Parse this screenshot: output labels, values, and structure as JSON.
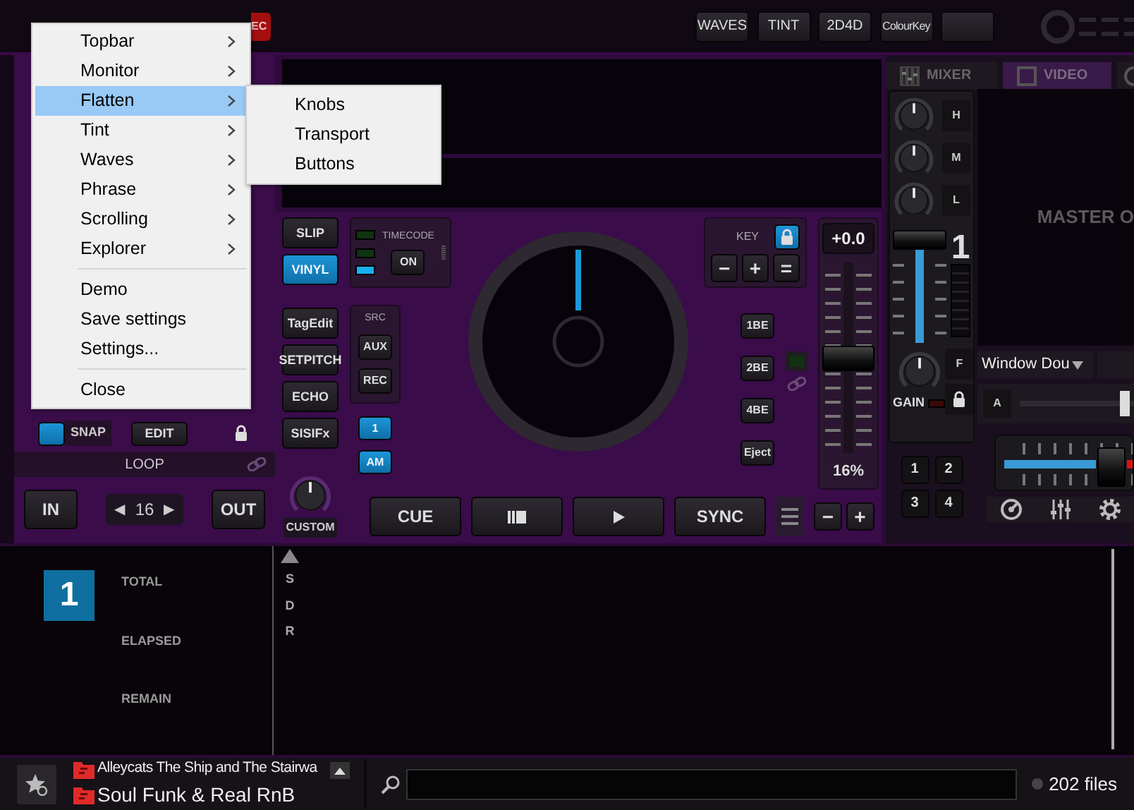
{
  "topbar": {
    "rec_label": "EC",
    "buttons": [
      {
        "label": "WAVES"
      },
      {
        "label": "TINT"
      },
      {
        "label": "2D4D"
      },
      {
        "label": "ColourKey"
      }
    ]
  },
  "deck": {
    "snap": {
      "label": "SNAP",
      "on": true
    },
    "edit_label": "EDIT",
    "loop_label": "LOOP",
    "loop_in": "IN",
    "loop_out": "OUT",
    "loop_prev": "◀",
    "loop_size": "16",
    "loop_next": "▶",
    "side_buttons": [
      {
        "label": "SLIP",
        "on": false
      },
      {
        "label": "VINYL",
        "on": true
      },
      {
        "label": "TagEdit",
        "on": false
      },
      {
        "label": "SETPITCH",
        "on": false
      },
      {
        "label": "ECHO",
        "on": false
      },
      {
        "label": "SISIFx",
        "on": false
      }
    ],
    "custom_label": "CUSTOM",
    "timecode": {
      "label": "TIMECODE",
      "button": "ON",
      "leds": [
        {
          "on": false
        },
        {
          "on": false
        },
        {
          "on": true
        }
      ]
    },
    "source": {
      "label": "SRC",
      "buttons": [
        "AUX",
        "REC"
      ]
    },
    "channel_buttons": [
      {
        "label": "1",
        "on": true
      },
      {
        "label": "AM",
        "on": true
      }
    ],
    "key": {
      "label": "KEY",
      "locked": true,
      "buttons": [
        "−",
        "+",
        "="
      ]
    },
    "beat_buttons": [
      "1BE",
      "2BE",
      "4BE",
      "Eject"
    ],
    "pitch": {
      "reading": "+0.0",
      "level": 0.5,
      "range": "16%",
      "buttons": [
        "−",
        "+"
      ]
    },
    "transport": [
      {
        "kind": "text",
        "label": "CUE"
      },
      {
        "kind": "pause-stop"
      },
      {
        "kind": "play"
      },
      {
        "kind": "text",
        "label": "SYNC"
      }
    ]
  },
  "mixer": {
    "tabs": [
      {
        "label": "MIXER",
        "selected": false
      },
      {
        "label": "VIDEO",
        "selected": true
      }
    ],
    "eq": [
      "H",
      "M",
      "L"
    ],
    "deck_number": "1",
    "filter_label": "F",
    "gain_label": "GAIN",
    "deck_buttons": [
      "1",
      "2",
      "3",
      "4"
    ]
  },
  "video": {
    "overlay": "MASTER O",
    "source": "Window Dou",
    "fader_label": "A",
    "video_fader": {
      "level": 0.92
    }
  },
  "info": {
    "deck_number": "1",
    "labels": [
      "TOTAL",
      "ELAPSED",
      "REMAIN"
    ],
    "sort_keys": [
      "S",
      "D",
      "R"
    ]
  },
  "browser": {
    "folders": [
      "Alleycats The Ship and The Stairwa",
      "Soul Funk & Real RnB"
    ],
    "file_count": "202 files"
  },
  "menu": {
    "items": [
      {
        "label": "Topbar",
        "kind": "submenu",
        "selected": false
      },
      {
        "label": "Monitor",
        "kind": "submenu",
        "selected": false
      },
      {
        "label": "Flatten",
        "kind": "submenu",
        "selected": true,
        "children": [
          {
            "label": "Knobs"
          },
          {
            "label": "Transport"
          },
          {
            "label": "Buttons"
          }
        ]
      },
      {
        "label": "Tint",
        "kind": "submenu",
        "selected": false
      },
      {
        "label": "Waves",
        "kind": "submenu",
        "selected": false
      },
      {
        "label": "Phrase",
        "kind": "submenu",
        "selected": false
      },
      {
        "label": "Scrolling",
        "kind": "submenu",
        "selected": false
      },
      {
        "label": "Explorer",
        "kind": "submenu",
        "selected": false
      },
      {
        "kind": "separator"
      },
      {
        "label": "Demo",
        "kind": "item",
        "selected": false
      },
      {
        "label": "Save settings",
        "kind": "item",
        "selected": false
      },
      {
        "label": "Settings...",
        "kind": "item",
        "selected": false
      },
      {
        "kind": "separator"
      },
      {
        "label": "Close",
        "kind": "item",
        "selected": false
      }
    ]
  }
}
